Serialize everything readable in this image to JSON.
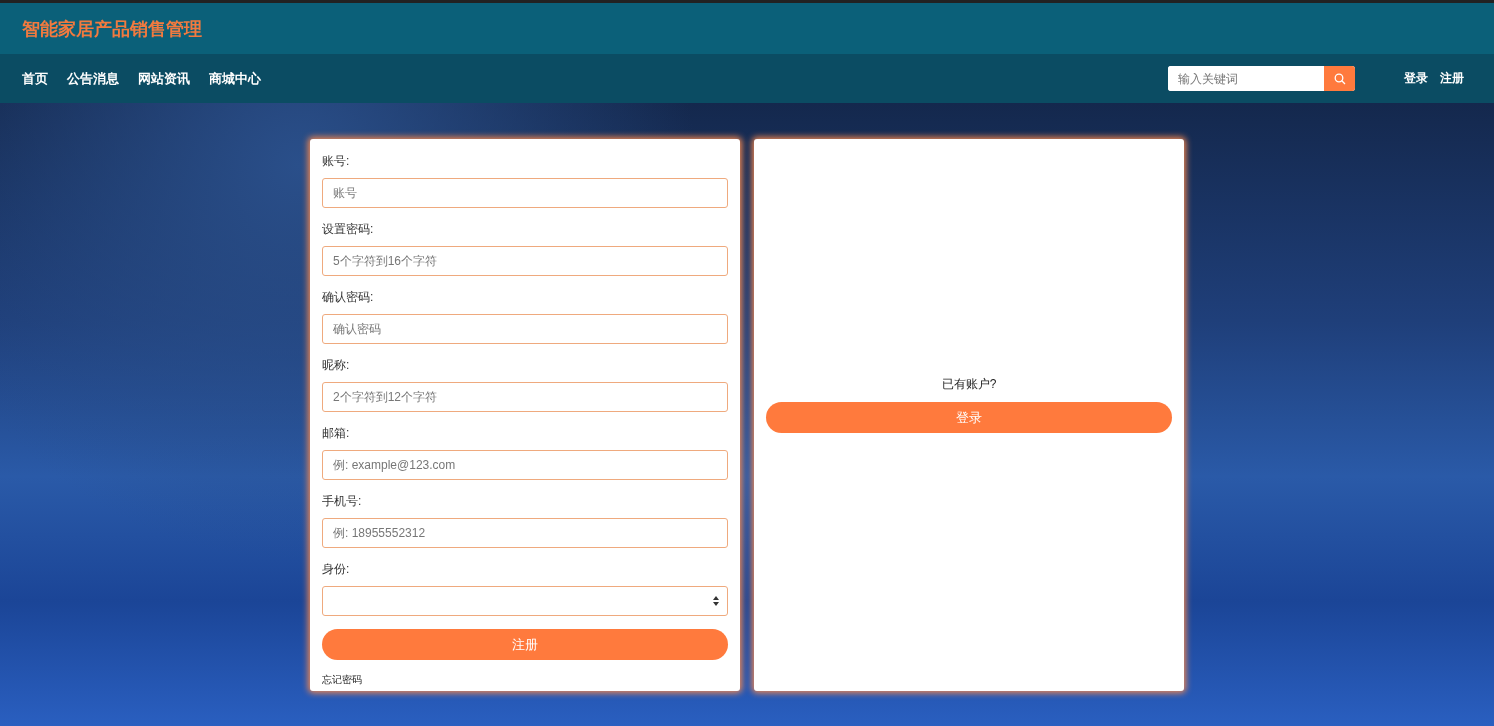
{
  "header": {
    "title": "智能家居产品销售管理"
  },
  "nav": {
    "items": [
      {
        "label": "首页"
      },
      {
        "label": "公告消息"
      },
      {
        "label": "网站资讯"
      },
      {
        "label": "商城中心"
      }
    ],
    "search": {
      "placeholder": "输入关键词"
    },
    "links": [
      {
        "label": "登录"
      },
      {
        "label": "注册"
      }
    ]
  },
  "register_form": {
    "fields": [
      {
        "kind": "input",
        "label": "账号:",
        "placeholder": "账号"
      },
      {
        "kind": "input",
        "label": "设置密码:",
        "placeholder": "5个字符到16个字符"
      },
      {
        "kind": "input",
        "label": "确认密码:",
        "placeholder": "确认密码"
      },
      {
        "kind": "input",
        "label": "昵称:",
        "placeholder": "2个字符到12个字符"
      },
      {
        "kind": "input",
        "label": "邮箱:",
        "placeholder": "例: example@123.com"
      },
      {
        "kind": "input",
        "label": "手机号:",
        "placeholder": "例: 18955552312"
      },
      {
        "kind": "select",
        "label": "身份:"
      }
    ],
    "submit": "注册",
    "forgot_link": "忘记密码"
  },
  "login_panel": {
    "prompt": "已有账户?",
    "button": "登录"
  }
}
